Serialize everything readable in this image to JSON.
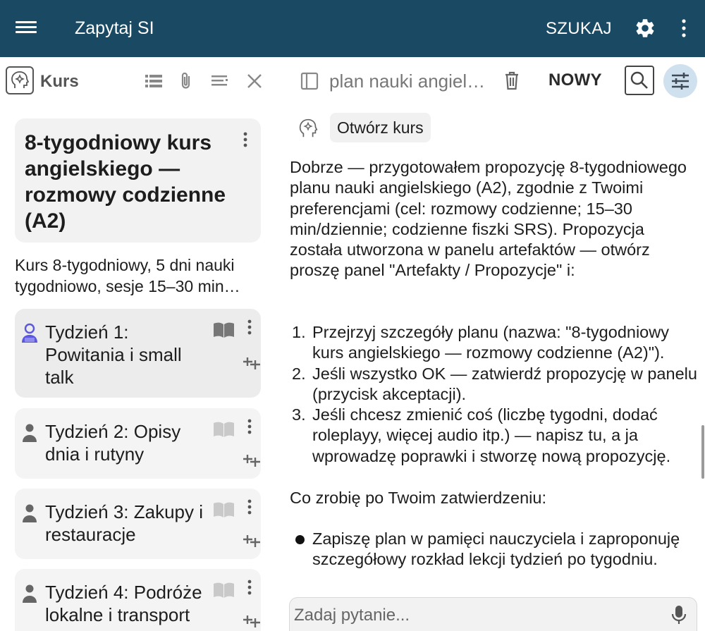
{
  "appbar": {
    "title": "Zapytaj SI",
    "search_label": "SZUKAJ",
    "menu_icon": "hamburger-menu-icon",
    "settings_icon": "gear-icon",
    "overflow_icon": "more-vert-icon",
    "background": "#1a4a63"
  },
  "left_panel": {
    "header": {
      "label": "Kurs",
      "icons": [
        "list-icon",
        "paperclip-icon",
        "sort-lines-icon",
        "close-icon"
      ]
    },
    "course": {
      "title": "8-tygodniowy kurs angielskiego — rozmowy codzienne (A2)",
      "description": "Kurs 8-tygodniowy, 5 dni nauki tygodniowo, sesje 15–30 min…"
    },
    "weeks": [
      {
        "title": "Tydzień 1: Powitania i small talk",
        "active": true
      },
      {
        "title": "Tydzień 2: Opisy dnia i rutyny",
        "active": false
      },
      {
        "title": "Tydzień 3: Zakupy i restauracje",
        "active": false
      },
      {
        "title": "Tydzień 4: Podróże lokalne i transport",
        "active": false
      }
    ]
  },
  "chat_header": {
    "title": "plan nauki angielskiego",
    "new_label": "NOWY",
    "icons": [
      "side-panel-icon",
      "trash-icon",
      "search-icon",
      "tune-sliders-icon"
    ]
  },
  "chat": {
    "open_course_label": "Otwórz kurs",
    "intro": "Dobrze — przygotowałem propozycję 8-tygodniowego planu nauki angielskiego (A2), zgodnie z Twoimi preferencjami (cel: rozmowy codzienne; 15–30 min/dziennie; codzienne fiszki SRS). Propozycja została utworzona w panelu artefaktów — otwórz proszę panel \"Artefakty / Propozycje\" i:",
    "steps": [
      "Przejrzyj szczegóły planu (nazwa: \"8-tygodniowy kurs angielskiego — rozmowy codzienne (A2)\").",
      "Jeśli wszystko OK — zatwierdź propozycję w panelu (przycisk akceptacji).",
      "Jeśli chcesz zmienić coś (liczbę tygodni, dodać roleplayy, więcej audio itp.) — napisz tu, a ja wprowadzę poprawki i stworzę nową propozycję."
    ],
    "after_heading": "Co zrobię po Twoim zatwierdzeniu:",
    "bullets": [
      "Zapiszę plan w pamięci nauczyciela i zaproponuję szczegółowy rozkład lekcji tydzień po tygodniu."
    ]
  },
  "input": {
    "placeholder": "Zadaj pytanie...",
    "mic_icon": "microphone-icon"
  }
}
